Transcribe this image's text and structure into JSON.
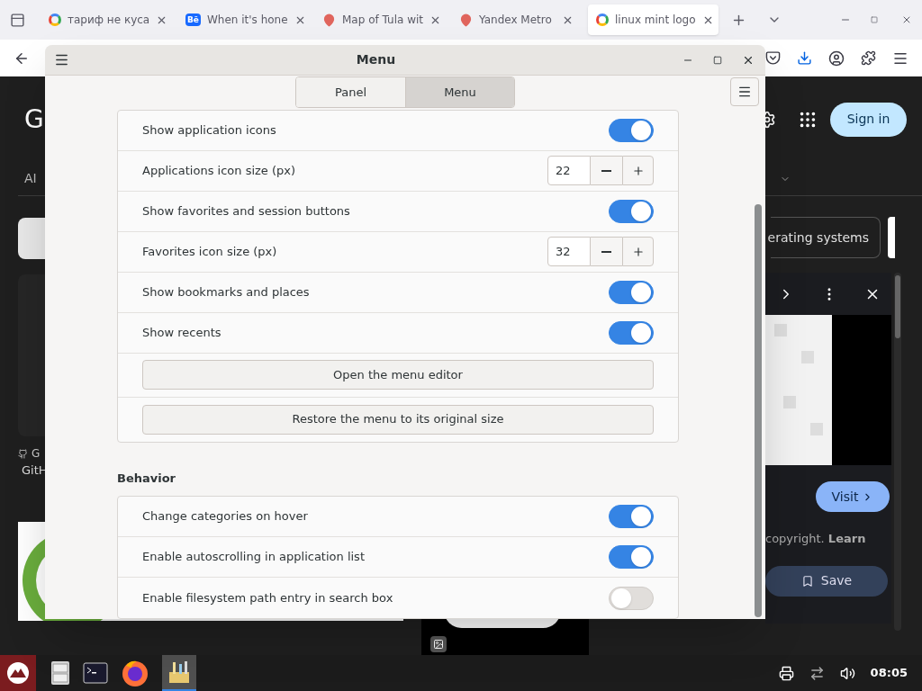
{
  "browser": {
    "tabs": [
      {
        "kind": "google",
        "title": "тариф не куса",
        "selected": false
      },
      {
        "kind": "behance",
        "badge": "Bē",
        "title": "When it's hone",
        "selected": false
      },
      {
        "kind": "pin",
        "title": "Map of Tula wit",
        "selected": false
      },
      {
        "kind": "pin",
        "title": "Yandex Metro",
        "selected": false
      },
      {
        "kind": "google",
        "title": "linux mint logo",
        "selected": true
      }
    ]
  },
  "page": {
    "logo": "G",
    "nav": "AI",
    "sign_in": "Sign in",
    "chip": "erating systems",
    "source_letter": "G",
    "source": "GitH",
    "visit": "Visit",
    "note": "copyright. **Learn**",
    "save": "Save"
  },
  "dialog": {
    "title": "Menu",
    "tabs": [
      {
        "label": "Panel",
        "selected": false
      },
      {
        "label": "Menu",
        "selected": true
      }
    ],
    "sections": [
      {
        "rows": [
          {
            "kind": "switch",
            "label": "Show application icons",
            "on": true
          },
          {
            "kind": "spin",
            "label": "Applications icon size (px)",
            "value": "22"
          },
          {
            "kind": "switch",
            "label": "Show favorites and session buttons",
            "on": true
          },
          {
            "kind": "spin",
            "label": "Favorites icon size (px)",
            "value": "32"
          },
          {
            "kind": "switch",
            "label": "Show bookmarks and places",
            "on": true
          },
          {
            "kind": "switch",
            "label": "Show recents",
            "on": true
          },
          {
            "kind": "button",
            "label": "Open the menu editor"
          },
          {
            "kind": "button",
            "label": "Restore the menu to its original size"
          }
        ]
      },
      {
        "heading": "Behavior",
        "rows": [
          {
            "kind": "switch",
            "label": "Change categories on hover",
            "on": true
          },
          {
            "kind": "switch",
            "label": "Enable autoscrolling in application list",
            "on": true
          },
          {
            "kind": "switch",
            "label": "Enable filesystem path entry in search box",
            "on": false
          }
        ]
      }
    ]
  },
  "taskbar": {
    "clock": "08:05"
  }
}
